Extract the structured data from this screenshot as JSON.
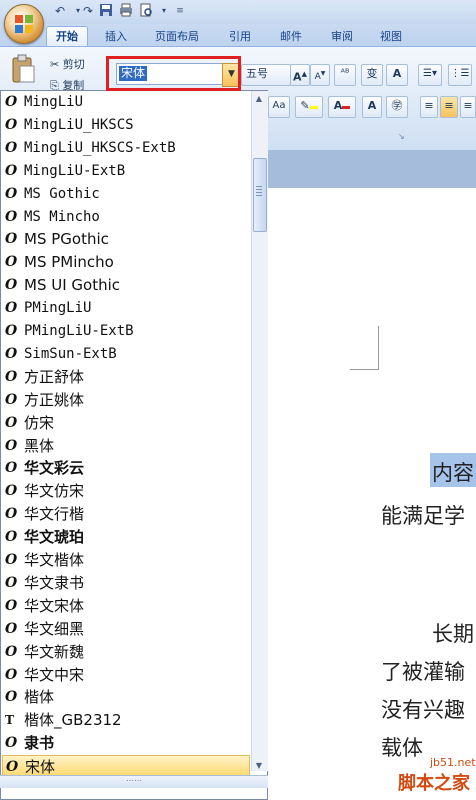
{
  "ribbon": {
    "tabs": [
      "开始",
      "插入",
      "页面布局",
      "引用",
      "邮件",
      "审阅",
      "视图"
    ],
    "active_tab": "开始",
    "clipboard": {
      "cut_label": "剪切",
      "copy_label": "复制"
    },
    "font_name": "宋体",
    "font_size": "五号"
  },
  "font_list": {
    "fonts": [
      {
        "name": "MingLiU",
        "style": "mono",
        "icon": "O"
      },
      {
        "name": "MingLiU_HKSCS",
        "style": "mono",
        "icon": "O"
      },
      {
        "name": "MingLiU_HKSCS-ExtB",
        "style": "mono",
        "icon": "O"
      },
      {
        "name": "MingLiU-ExtB",
        "style": "mono",
        "icon": "O"
      },
      {
        "name": "MS Gothic",
        "style": "mono",
        "icon": "O"
      },
      {
        "name": "MS Mincho",
        "style": "mono",
        "icon": "O"
      },
      {
        "name": "MS PGothic",
        "style": "",
        "icon": "O"
      },
      {
        "name": "MS PMincho",
        "style": "",
        "icon": "O"
      },
      {
        "name": "MS UI Gothic",
        "style": "",
        "icon": "O"
      },
      {
        "name": "PMingLiU",
        "style": "mono",
        "icon": "O"
      },
      {
        "name": "PMingLiU-ExtB",
        "style": "mono",
        "icon": "O"
      },
      {
        "name": "SimSun-ExtB",
        "style": "mono",
        "icon": "O"
      },
      {
        "name": "方正舒体",
        "style": "",
        "icon": "O"
      },
      {
        "name": "方正姚体",
        "style": "",
        "icon": "O"
      },
      {
        "name": "仿宋",
        "style": "",
        "icon": "O"
      },
      {
        "name": "黑体",
        "style": "",
        "icon": "O"
      },
      {
        "name": "华文彩云",
        "style": "bold",
        "icon": "O"
      },
      {
        "name": "华文仿宋",
        "style": "",
        "icon": "O"
      },
      {
        "name": "华文行楷",
        "style": "",
        "icon": "O"
      },
      {
        "name": "华文琥珀",
        "style": "bold",
        "icon": "O"
      },
      {
        "name": "华文楷体",
        "style": "",
        "icon": "O"
      },
      {
        "name": "华文隶书",
        "style": "",
        "icon": "O"
      },
      {
        "name": "华文宋体",
        "style": "",
        "icon": "O"
      },
      {
        "name": "华文细黑",
        "style": "",
        "icon": "O"
      },
      {
        "name": "华文新魏",
        "style": "",
        "icon": "O"
      },
      {
        "name": "华文中宋",
        "style": "",
        "icon": "O"
      },
      {
        "name": "楷体",
        "style": "",
        "icon": "O"
      },
      {
        "name": "楷体_GB2312",
        "style": "",
        "icon": "T"
      },
      {
        "name": "隶书",
        "style": "bold",
        "icon": "O"
      },
      {
        "name": "宋体",
        "style": "",
        "icon": "O",
        "selected": true
      }
    ]
  },
  "document": {
    "lines": [
      "内容",
      "能满足学",
      "长期",
      "了被灌输",
      "没有兴趣",
      "载体"
    ]
  },
  "watermark": {
    "url": "jb51.net",
    "name": "脚本之家"
  },
  "colors": {
    "highlight_box": "#e02020",
    "selected_item": "#ffd86c",
    "ribbon_border": "#8db2e3"
  }
}
